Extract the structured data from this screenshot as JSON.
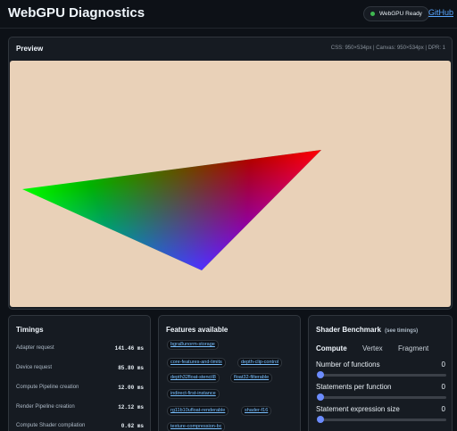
{
  "header": {
    "title": "WebGPU Diagnostics",
    "status": "WebGPU Ready",
    "github_link": "GitHub"
  },
  "preview": {
    "title": "Preview",
    "canvas_info": "CSS: 950×534px | Canvas: 950×534px | DPR: 1",
    "triangle_colors": {
      "left": "#00ff00",
      "right": "#ff0000",
      "bottom": "#0000ff"
    },
    "background_color": "#e9d1b8"
  },
  "timings": {
    "title": "Timings",
    "rows": [
      {
        "label": "Adapter request",
        "value": "141.46 ms"
      },
      {
        "label": "Device request",
        "value": "85.80 ms"
      },
      {
        "label": "Compute Pipeline creation",
        "value": "12.00 ms"
      },
      {
        "label": "Render Pipeline creation",
        "value": "12.12 ms"
      },
      {
        "label": "Compute Shader compilation",
        "value": "0.62 ms"
      }
    ]
  },
  "features": {
    "title": "Features available",
    "items": [
      "bgra8unorm-storage",
      "core-features-and-limits",
      "depth-clip-control",
      "depth32float-stencil8",
      "float32-filterable",
      "indirect-first-instance",
      "rg11b10ufloat-renderable",
      "shader-f16",
      "texture-compression-bc"
    ]
  },
  "benchmark": {
    "title": "Shader Benchmark",
    "subtitle": "(see timings)",
    "tabs": [
      "Compute",
      "Vertex",
      "Fragment"
    ],
    "active_tab": "Compute",
    "sliders": [
      {
        "label": "Number of functions",
        "value": "0"
      },
      {
        "label": "Statements per function",
        "value": "0"
      },
      {
        "label": "Statement expression size",
        "value": "0"
      }
    ]
  }
}
